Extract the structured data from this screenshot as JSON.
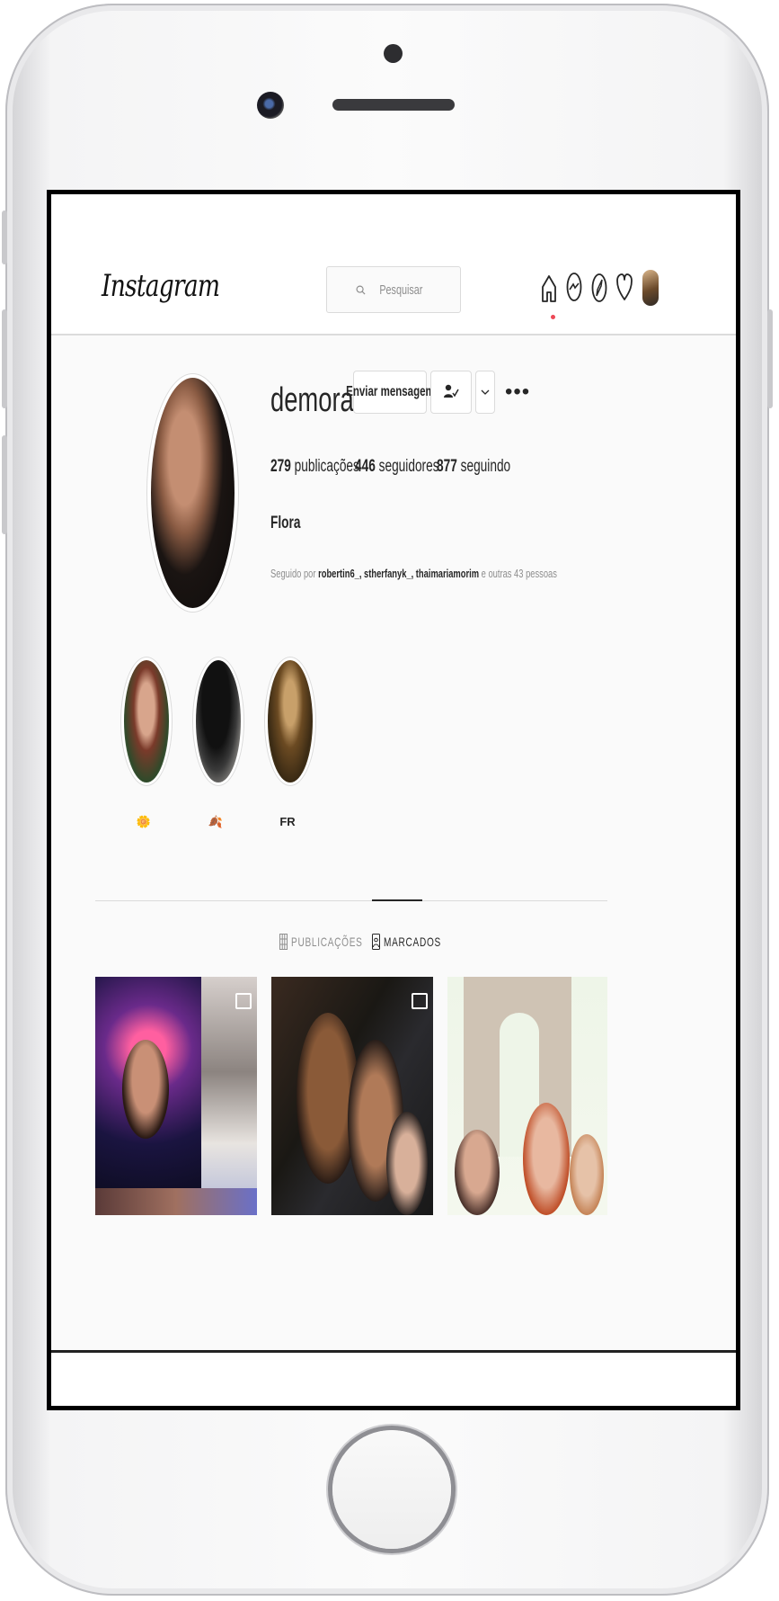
{
  "app": {
    "logo_text": "Instagram",
    "search_placeholder": "Pesquisar"
  },
  "nav": {
    "icons": [
      "home-icon",
      "messenger-icon",
      "explore-icon",
      "heart-icon",
      "profile-avatar"
    ],
    "active": "home-icon",
    "notification_color": "#ed4956"
  },
  "profile": {
    "username": "demoraese",
    "message_button": "Enviar mensagem",
    "following_button_icon": "person-check-icon",
    "dropdown_icon": "chevron-down-icon",
    "more_label": "•••",
    "stats": {
      "posts_count": "279",
      "posts_label": " publicações",
      "followers_count": "446",
      "followers_label": " seguidores",
      "following_count": "877",
      "following_label": " seguindo"
    },
    "full_name": "Flora",
    "followed_by_prefix": "Seguido por ",
    "followed_by_names": "robertin6_, stherfanyk_, thaimariamorim",
    "followed_by_suffix": " e outras 43 pessoas"
  },
  "highlights": [
    {
      "label": "🌼"
    },
    {
      "label": "🍂"
    },
    {
      "label": "FR"
    }
  ],
  "tabs": [
    {
      "label": "PUBLICAÇÕES",
      "icon": "grid-icon",
      "active": false
    },
    {
      "label": "MARCADOS",
      "icon": "tagged-icon",
      "active": true
    }
  ],
  "colors": {
    "text_primary": "#262626",
    "text_secondary": "#8e8e8e",
    "border": "#dbdbdb",
    "background": "#fafafa"
  }
}
